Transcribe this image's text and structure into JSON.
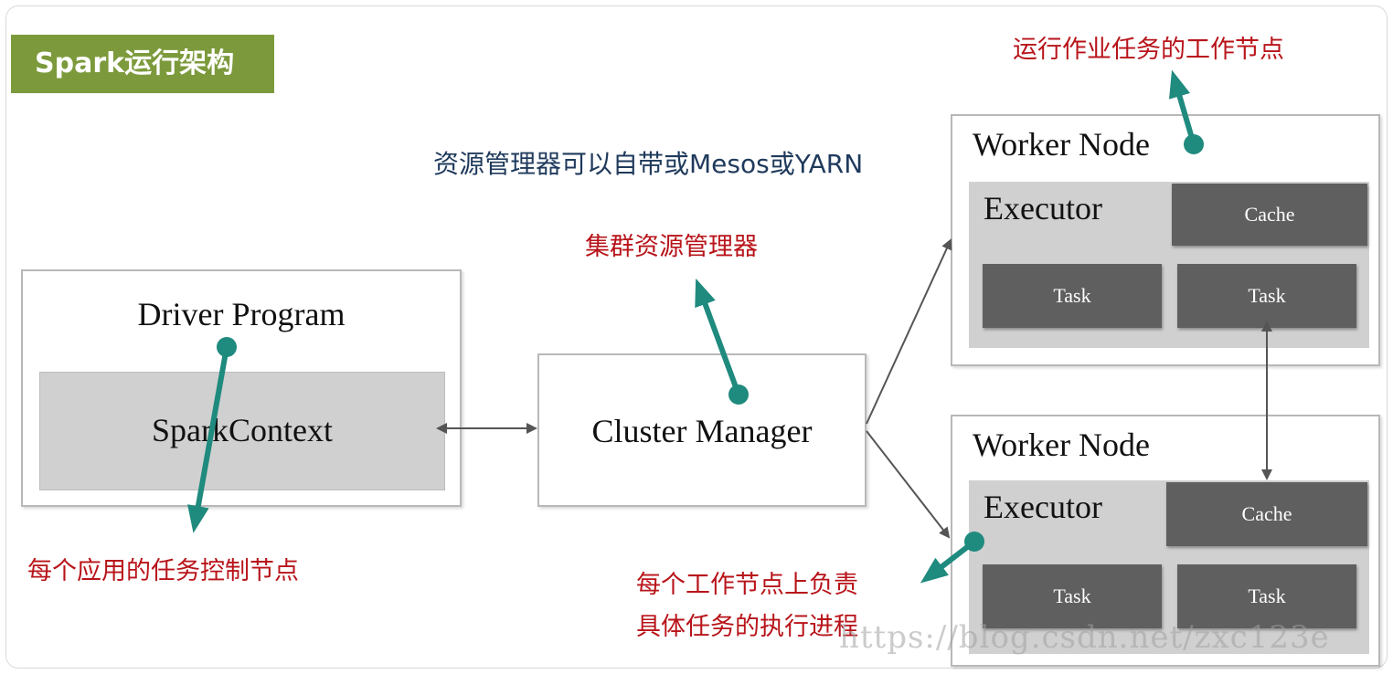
{
  "title": "Spark运行架构",
  "annotations": {
    "worker_task_node": "运行作业任务的工作节点",
    "resource_manager_note": "资源管理器可以自带或Mesos或YARN",
    "cluster_resource_manager": "集群资源管理器",
    "driver_control_node": "每个应用的任务控制节点",
    "executor_process_line1": "每个工作节点上负责",
    "executor_process_line2": "具体任务的执行进程"
  },
  "driver": {
    "title": "Driver Program",
    "context": "SparkContext"
  },
  "cluster_manager": {
    "title": "Cluster Manager"
  },
  "worker_nodes": [
    {
      "title": "Worker Node",
      "executor": "Executor",
      "cache": "Cache",
      "tasks": [
        "Task",
        "Task"
      ]
    },
    {
      "title": "Worker Node",
      "executor": "Executor",
      "cache": "Cache",
      "tasks": [
        "Task",
        "Task"
      ]
    }
  ],
  "watermark": "https://blog.csdn.net/zxc123e",
  "colors": {
    "title_bg": "#7c9a3c",
    "annotation_red": "#b8141a",
    "annotation_blue": "#1f3a5c",
    "pointer_teal": "#1f8a7e",
    "dark_block": "#5f5f5f",
    "grey_panel": "#d0d0d0"
  }
}
